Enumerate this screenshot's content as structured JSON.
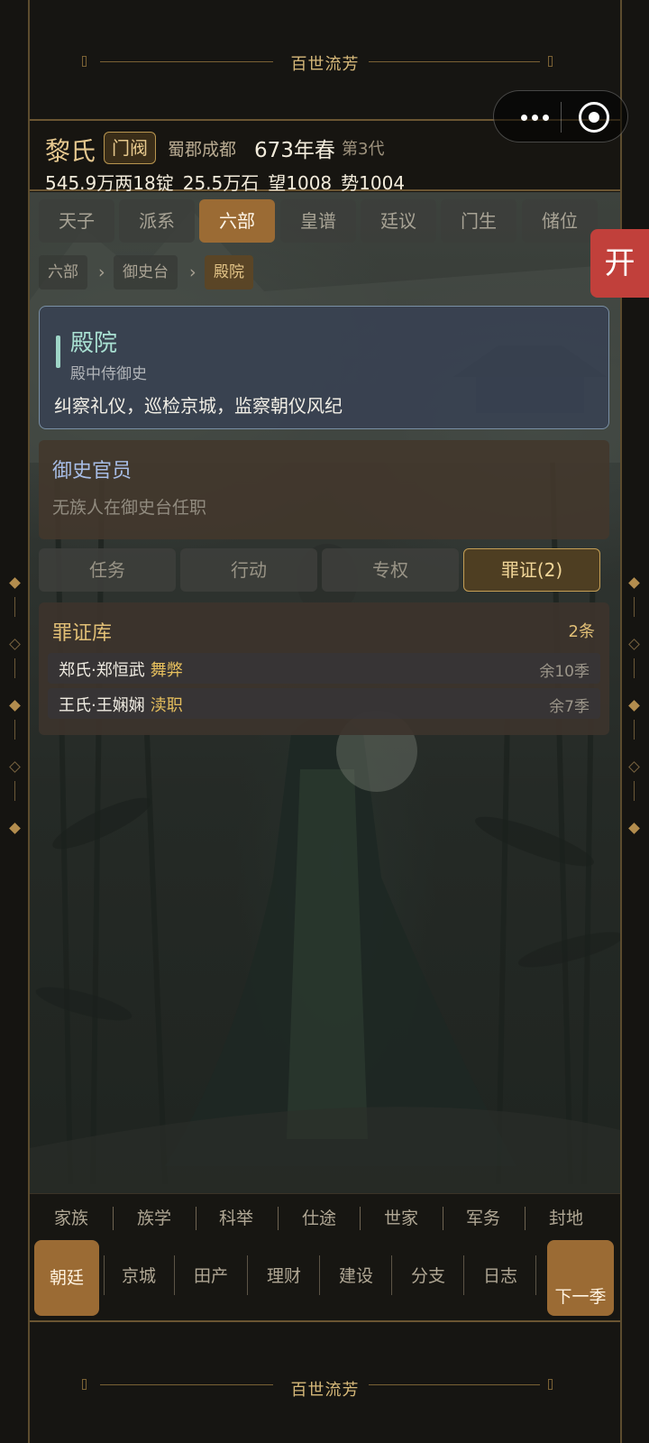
{
  "banner": {
    "title": "百世流芳"
  },
  "footer_banner": {
    "title": "百世流芳"
  },
  "header": {
    "family_name": "黎氏",
    "rank": "门阀",
    "place": "蜀郡成都",
    "year": "673年春",
    "generation": "第3代",
    "stats": [
      "545.9万两",
      "18锭",
      "25.5万石",
      "望1008",
      "势1004"
    ]
  },
  "top_tabs": [
    {
      "label": "天子",
      "active": false
    },
    {
      "label": "派系",
      "active": false
    },
    {
      "label": "六部",
      "active": true
    },
    {
      "label": "皇谱",
      "active": false
    },
    {
      "label": "廷议",
      "active": false
    },
    {
      "label": "门生",
      "active": false
    },
    {
      "label": "储位",
      "active": false
    }
  ],
  "breadcrumb": [
    "六部",
    "御史台",
    "殿院"
  ],
  "department": {
    "name": "殿院",
    "official_title": "殿中侍御史",
    "description": "纠察礼仪，巡检京城，监察朝仪风纪"
  },
  "officials": {
    "heading": "御史官员",
    "empty_text": "无族人在御史台任职"
  },
  "sub_tabs": [
    {
      "label": "任务",
      "active": false
    },
    {
      "label": "行动",
      "active": false
    },
    {
      "label": "专权",
      "active": false
    },
    {
      "label": "罪证(2)",
      "active": true
    }
  ],
  "evidence": {
    "heading": "罪证库",
    "count": "2条",
    "items": [
      {
        "person": "郑氏·郑恒武",
        "crime": "舞弊",
        "remaining": "余10季"
      },
      {
        "person": "王氏·王娴娴",
        "crime": "渎职",
        "remaining": "余7季"
      }
    ]
  },
  "nav_row1": [
    "家族",
    "族学",
    "科举",
    "仕途",
    "世家",
    "军务",
    "封地"
  ],
  "nav_row2": [
    "朝廷",
    "京城",
    "田产",
    "理财",
    "建设",
    "分支",
    "日志"
  ],
  "nav_active": "朝廷",
  "next_button": "下一季",
  "float_button": "开",
  "icons": {
    "capsule_menu": "more-dots-icon",
    "capsule_close": "target-circle-icon",
    "breadcrumb_sep": "chevron-right-icon"
  },
  "colors": {
    "accent": "#9b6b34",
    "gold_text": "#e1bf76",
    "float_red": "#c1403b",
    "dept_title": "#a9e0d2"
  }
}
